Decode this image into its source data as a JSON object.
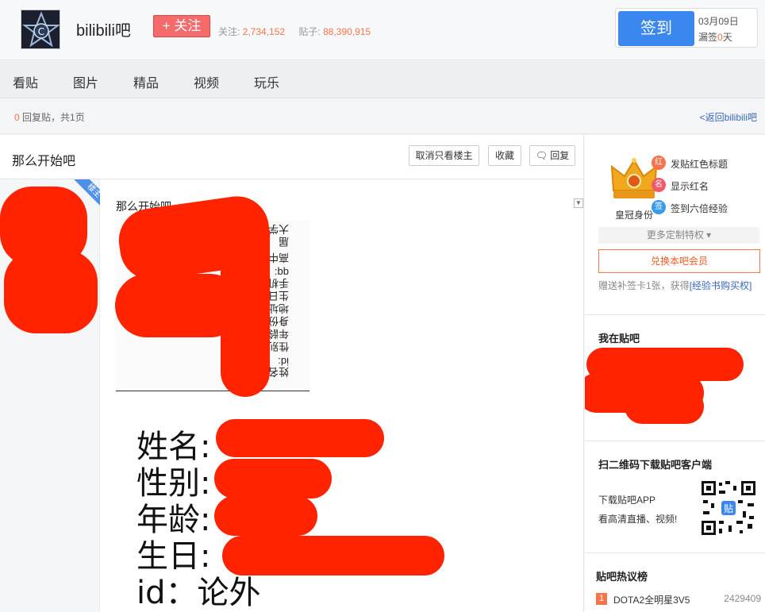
{
  "header": {
    "bar_name": "bilibili吧",
    "follow_label": "+ 关注",
    "follow_label_prefix": "关注:",
    "follow_count": "2,734,152",
    "posts_label_prefix": "贴子:",
    "posts_count": "88,390,915",
    "signin_label": "签到",
    "signin_date": "03月09日",
    "missed_prefix": "漏签",
    "missed_days": "0",
    "missed_suffix": "天"
  },
  "nav": {
    "items": [
      "看贴",
      "图片",
      "精品",
      "视频",
      "玩乐"
    ]
  },
  "subbar": {
    "reply_count": "0",
    "reply_text": " 回复贴，共",
    "pages": "1",
    "pages_suffix": "页",
    "back_link": "<返回bilibili吧"
  },
  "post": {
    "title": "那么开始吧",
    "btn_only_author": "取消只看楼主",
    "btn_collect": "收藏",
    "btn_reply": "回复",
    "author_badge": "楼主",
    "content_text": "那么开始吧",
    "image1_lines": [
      "姓名",
      "id:",
      "性别",
      "年龄",
      "身份",
      "地址",
      "生日",
      "手机",
      "qq:",
      "高中",
      "届",
      "大学"
    ],
    "image2_lines": [
      "姓名:",
      "性别:",
      "年龄:",
      "生日:",
      "id：论外"
    ]
  },
  "sidebar": {
    "crown_label": "皇冠身份",
    "privileges": [
      {
        "icon": "红",
        "label": "发贴红色标题"
      },
      {
        "icon": "名",
        "label": "显示红名"
      },
      {
        "icon": "签",
        "label": "签到六倍经验"
      }
    ],
    "more_privileges": "更多定制特权 ▾",
    "exchange_button": "兑换本吧会员",
    "gift_text": "赠送补签卡1张，获得",
    "gift_link": "[经验书购买权]",
    "my_bars_title": "我在贴吧",
    "qr_title": "扫二维码下载贴吧客户端",
    "app_line1": "下载贴吧APP",
    "app_line2": "看高清直播、视频!",
    "qr_badge": "贴",
    "hot_title": "贴吧热议榜",
    "hot_items": [
      {
        "rank": "1",
        "title": "DOTA2全明星3V5",
        "count": "2429409"
      }
    ]
  },
  "colors": {
    "accent_blue": "#3b87f0",
    "follow_red": "#f56a6a",
    "orange": "#f7744a",
    "scribble_red": "#ff2300"
  }
}
